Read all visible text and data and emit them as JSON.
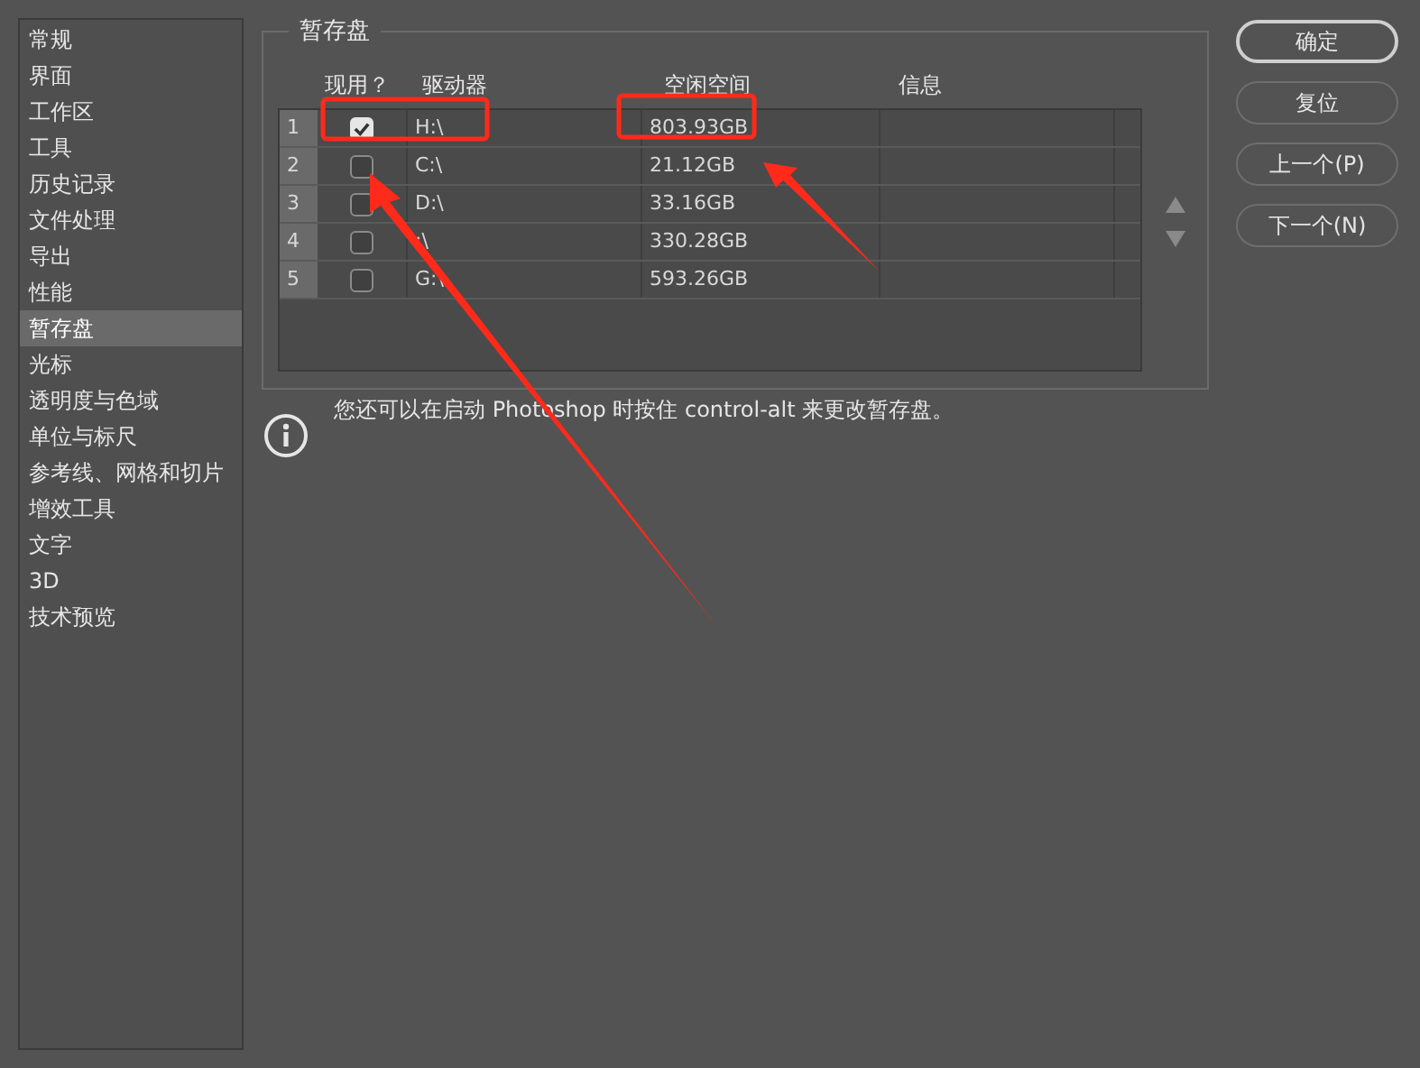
{
  "sidebar": {
    "items": [
      {
        "label": "常规",
        "selected": false
      },
      {
        "label": "界面",
        "selected": false
      },
      {
        "label": "工作区",
        "selected": false
      },
      {
        "label": "工具",
        "selected": false
      },
      {
        "label": "历史记录",
        "selected": false
      },
      {
        "label": "文件处理",
        "selected": false
      },
      {
        "label": "导出",
        "selected": false
      },
      {
        "label": "性能",
        "selected": false
      },
      {
        "label": "暂存盘",
        "selected": true
      },
      {
        "label": "光标",
        "selected": false
      },
      {
        "label": "透明度与色域",
        "selected": false
      },
      {
        "label": "单位与标尺",
        "selected": false
      },
      {
        "label": "参考线、网格和切片",
        "selected": false
      },
      {
        "label": "增效工具",
        "selected": false
      },
      {
        "label": "文字",
        "selected": false
      },
      {
        "label": "3D",
        "selected": false
      },
      {
        "label": "技术预览",
        "selected": false
      }
    ]
  },
  "scratch_disks": {
    "title": "暂存盘",
    "columns": [
      "现用？",
      "驱动器",
      "空闲空间",
      "信息"
    ],
    "rows": [
      {
        "index": "1",
        "checked": true,
        "drive": "H:\\",
        "free": "803.93GB"
      },
      {
        "index": "2",
        "checked": false,
        "drive": "C:\\",
        "free": "21.12GB"
      },
      {
        "index": "3",
        "checked": false,
        "drive": "D:\\",
        "free": "33.16GB"
      },
      {
        "index": "4",
        "checked": false,
        "drive": ":\\",
        "free": "330.28GB"
      },
      {
        "index": "5",
        "checked": false,
        "drive": "G:\\",
        "free": "593.26GB"
      }
    ]
  },
  "note": "您还可以在启动 Photoshop 时按住 control-alt 来更改暂存盘。",
  "buttons": [
    {
      "label": "确定",
      "kind": "primary"
    },
    {
      "label": "复位",
      "kind": "normal"
    },
    {
      "label": "上一个(P)",
      "kind": "normal"
    },
    {
      "label": "下一个(N)",
      "kind": "normal"
    }
  ]
}
